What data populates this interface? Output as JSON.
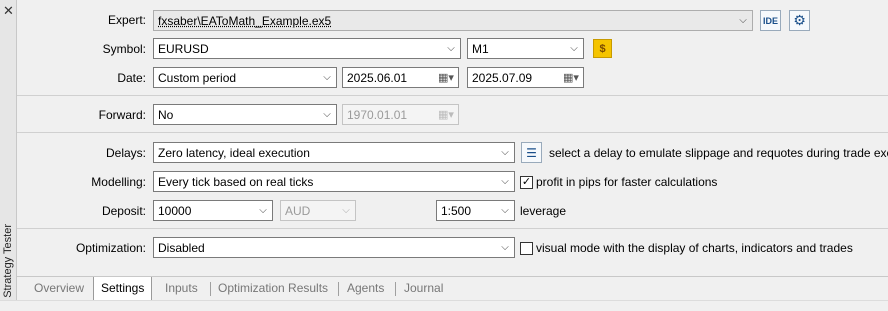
{
  "sidebar": {
    "close_glyph": "✕",
    "title": "Strategy Tester"
  },
  "expert": {
    "label": "Expert:",
    "value": "fxsaber\\EAToMath_Example.ex5",
    "ide_label": "IDE",
    "settings_icon": "gear-icon"
  },
  "symbol": {
    "label": "Symbol:",
    "value": "EURUSD",
    "timeframe": "M1",
    "icon": "dollar-icon",
    "icon_glyph": "$"
  },
  "date": {
    "label": "Date:",
    "period": "Custom period",
    "from": "2025.06.01",
    "to": "2025.07.09"
  },
  "forward": {
    "label": "Forward:",
    "value": "No",
    "date": "1970.01.01"
  },
  "delays": {
    "label": "Delays:",
    "value": "Zero latency, ideal execution",
    "hint": "select a delay to emulate slippage and requotes during trade execution"
  },
  "modelling": {
    "label": "Modelling:",
    "value": "Every tick based on real ticks",
    "profit_pips_label": "profit in pips for faster calculations",
    "profit_pips_checked": true
  },
  "deposit": {
    "label": "Deposit:",
    "amount": "10000",
    "currency": "AUD",
    "leverage_value": "1:500",
    "leverage_label": "leverage"
  },
  "optimization": {
    "label": "Optimization:",
    "value": "Disabled",
    "visual_mode_label": "visual mode with the display of charts, indicators and trades",
    "visual_mode_checked": false
  },
  "tabs": [
    "Overview",
    "Settings",
    "Inputs",
    "Optimization Results",
    "Agents",
    "Journal"
  ],
  "active_tab": "Settings",
  "colors": {
    "accent": "#1a4f8a",
    "dollar": "#f5c400"
  },
  "glyphs": {
    "dropdown": "⌵",
    "calendar": "▦▾",
    "check": "✓"
  }
}
